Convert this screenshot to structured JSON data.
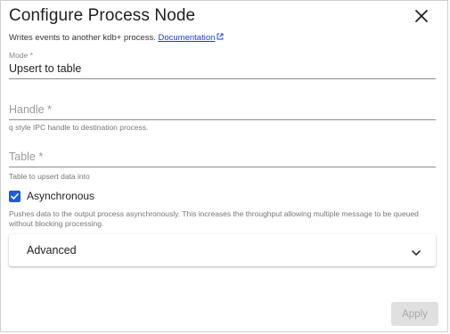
{
  "dialog": {
    "title": "Configure Process Node",
    "description": "Writes events to another kdb+ process.",
    "doc_link": "Documentation"
  },
  "mode": {
    "label": "Mode *",
    "value": "Upsert to table"
  },
  "handle": {
    "placeholder": "Handle *",
    "helper": "q style IPC handle to destination process."
  },
  "table": {
    "placeholder": "Table *",
    "helper": "Table to upsert data into"
  },
  "asynchronous": {
    "label": "Asynchronous",
    "checked": true,
    "helper": "Pushes data to the output process asynchronously. This increases the throughput allowing multiple message to be queued without blocking processing."
  },
  "advanced": {
    "label": "Advanced"
  },
  "actions": {
    "apply": "Apply"
  },
  "colors": {
    "accent": "#1e5bd8",
    "link": "#1a3fd4",
    "disabled_bg": "#e0e0e0"
  },
  "icons": [
    "close-icon",
    "external-link-icon",
    "check-icon",
    "chevron-down-icon"
  ]
}
